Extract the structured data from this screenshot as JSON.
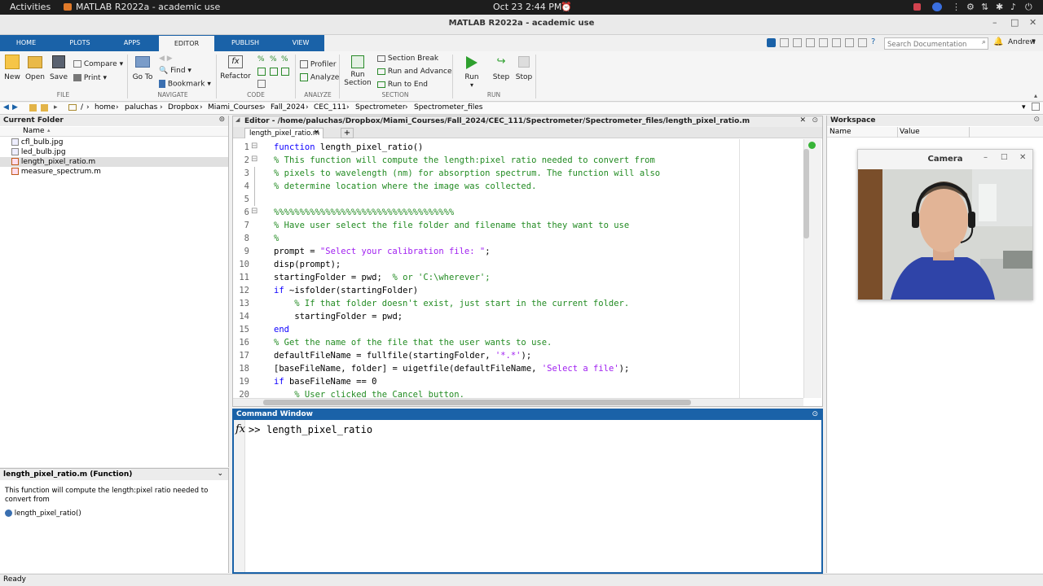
{
  "topbar": {
    "activities": "Activities",
    "app": "MATLAB R2022a - academic use",
    "clock": "Oct 23  2:44 PM"
  },
  "window": {
    "title": "MATLAB R2022a - academic use"
  },
  "tabs": [
    "HOME",
    "PLOTS",
    "APPS",
    "EDITOR",
    "PUBLISH",
    "VIEW"
  ],
  "search": {
    "placeholder": "Search Documentation"
  },
  "user": "Andrew",
  "ribbon": {
    "file": {
      "new": "New",
      "open": "Open",
      "save": "Save",
      "compare": "Compare",
      "print": "Print",
      "label": "FILE"
    },
    "navigate": {
      "goto": "Go To",
      "find": "Find",
      "bookmark": "Bookmark",
      "label": "NAVIGATE"
    },
    "code": {
      "refactor": "Refactor",
      "label": "CODE"
    },
    "analyze": {
      "profiler": "Profiler",
      "analyze": "Analyze",
      "label": "ANALYZE"
    },
    "section": {
      "run_section_1": "Run",
      "run_section_2": "Section",
      "section_break": "Section Break",
      "run_advance": "Run and Advance",
      "run_end": "Run to End",
      "label": "SECTION"
    },
    "run": {
      "run": "Run",
      "step": "Step",
      "stop": "Stop",
      "label": "RUN"
    }
  },
  "address": {
    "root": "/",
    "path": [
      "home",
      "paluchas",
      "Dropbox",
      "Miami_Courses",
      "Fall_2024",
      "CEC_111",
      "Spectrometer",
      "Spectrometer_files"
    ]
  },
  "current_folder": {
    "title": "Current Folder",
    "column": "Name",
    "files": [
      "cfl_bulb.jpg",
      "led_bulb.jpg",
      "length_pixel_ratio.m",
      "measure_spectrum.m"
    ]
  },
  "details": {
    "title": "length_pixel_ratio.m  (Function)",
    "description": "This function will compute the length:pixel ratio needed to convert from",
    "signature": "length_pixel_ratio()"
  },
  "editor": {
    "title": "Editor - /home/paluchas/Dropbox/Miami_Courses/Fall_2024/CEC_111/Spectrometer/Spectrometer_files/length_pixel_ratio.m",
    "tab": "length_pixel_ratio.m",
    "add_tab": "+",
    "lines": [
      {
        "n": "1",
        "t": "function length_pixel_ratio()"
      },
      {
        "n": "2",
        "t": "% This function will compute the length:pixel ratio needed to convert from"
      },
      {
        "n": "3",
        "t": "% pixels to wavelength (nm) for absorption spectrum. The function will also"
      },
      {
        "n": "4",
        "t": "% determine location where the image was collected."
      },
      {
        "n": "5",
        "t": ""
      },
      {
        "n": "6",
        "t": "%%%%%%%%%%%%%%%%%%%%%%%%%%%%%%%%%%%"
      },
      {
        "n": "7",
        "t": "% Have user select the file folder and filename that they want to use"
      },
      {
        "n": "8",
        "t": "%"
      },
      {
        "n": "9",
        "t": "prompt = \"Select your calibration file: \";"
      },
      {
        "n": "10",
        "t": "disp(prompt);"
      },
      {
        "n": "11",
        "t": "startingFolder = pwd;  % or 'C:\\wherever';"
      },
      {
        "n": "12",
        "t": "if ~isfolder(startingFolder)"
      },
      {
        "n": "13",
        "t": "    % If that folder doesn't exist, just start in the current folder."
      },
      {
        "n": "14",
        "t": "    startingFolder = pwd;"
      },
      {
        "n": "15",
        "t": "end"
      },
      {
        "n": "16",
        "t": "% Get the name of the file that the user wants to use."
      },
      {
        "n": "17",
        "t": "defaultFileName = fullfile(startingFolder, '*.*');"
      },
      {
        "n": "18",
        "t": "[baseFileName, folder] = uigetfile(defaultFileName, 'Select a file');"
      },
      {
        "n": "19",
        "t": "if baseFileName == 0"
      },
      {
        "n": "20",
        "t": "    % User clicked the Cancel button."
      }
    ]
  },
  "command_window": {
    "title": "Command Window",
    "prompt": ">>",
    "input": "length_pixel_ratio"
  },
  "workspace": {
    "title": "Workspace",
    "columns": [
      "Name",
      "Value"
    ]
  },
  "camera": {
    "title": "Camera"
  },
  "status": "Ready",
  "colors": {
    "accent": "#1a62a8",
    "keyword": "#0e00ff",
    "comment": "#228b22",
    "string": "#a020f0"
  }
}
